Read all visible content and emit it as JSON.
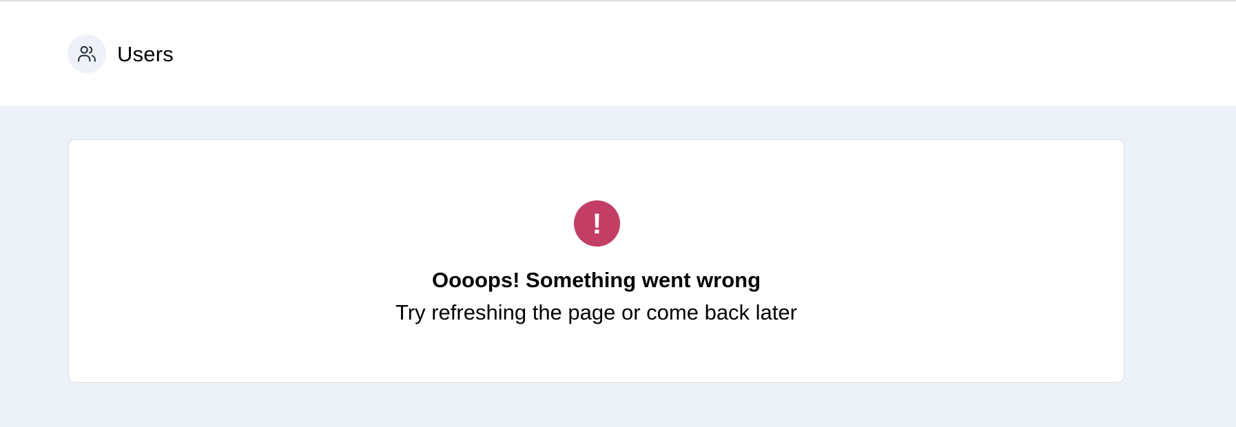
{
  "header": {
    "icon": "users-icon",
    "title": "Users"
  },
  "error": {
    "icon": "exclamation-icon",
    "icon_glyph": "!",
    "icon_color": "#c33e64",
    "title": "Oooops! Something went wrong",
    "message": "Try refreshing the page or come back later"
  },
  "colors": {
    "page_background": "#edf1f8",
    "card_background": "#ffffff",
    "card_border": "#dcdee3"
  }
}
